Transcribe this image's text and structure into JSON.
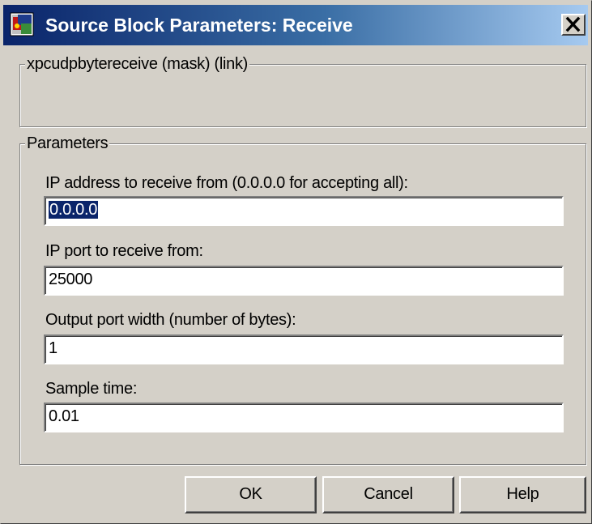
{
  "window": {
    "title": "Source Block Parameters: Receive",
    "close_symbol": "×",
    "titlebar_colors": [
      "#0a246a",
      "#a6caf0"
    ],
    "app_icon": "simulink-block-icon",
    "close_icon": "close-icon"
  },
  "mask_group": {
    "legend": "xpcudpbytereceive (mask) (link)"
  },
  "parameters_group": {
    "legend": "Parameters",
    "fields": [
      {
        "label": "IP address to receive from (0.0.0.0 for accepting all):",
        "value": "0.0.0.0",
        "selected": true
      },
      {
        "label": "IP port to receive from:",
        "value": "25000"
      },
      {
        "label": "Output port width (number of bytes):",
        "value": "1"
      },
      {
        "label": "Sample time:",
        "value": "0.01"
      }
    ]
  },
  "buttons": {
    "ok": "OK",
    "cancel": "Cancel",
    "help": "Help"
  }
}
